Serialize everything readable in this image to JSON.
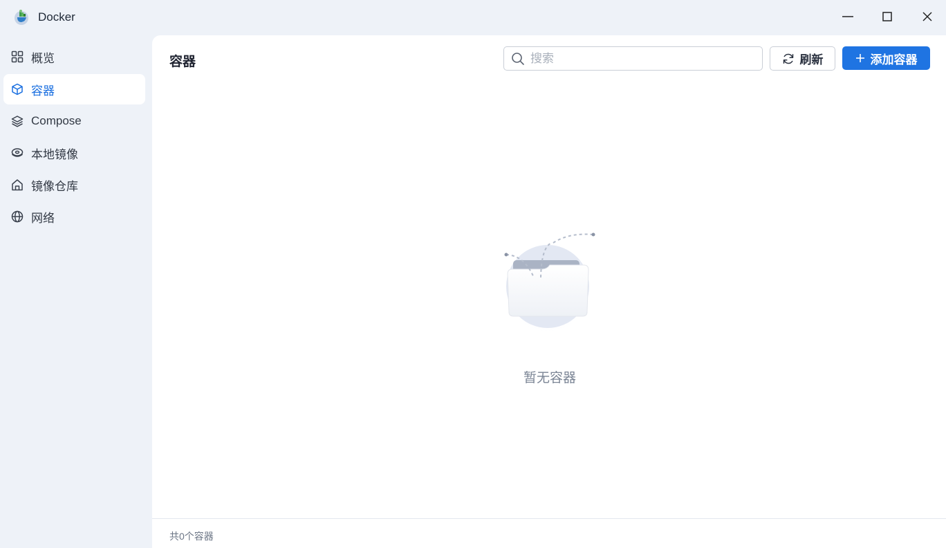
{
  "window": {
    "title": "Docker",
    "minimize_icon": "minimize-icon",
    "maximize_icon": "maximize-icon",
    "close_icon": "close-icon"
  },
  "sidebar": {
    "items": [
      {
        "label": "概览",
        "icon": "grid-icon",
        "active": false
      },
      {
        "label": "容器",
        "icon": "cube-icon",
        "active": true
      },
      {
        "label": "Compose",
        "icon": "layers-icon",
        "active": false
      },
      {
        "label": "本地镜像",
        "icon": "disk-icon",
        "active": false
      },
      {
        "label": "镜像仓库",
        "icon": "home-icon",
        "active": false
      },
      {
        "label": "网络",
        "icon": "globe-icon",
        "active": false
      }
    ]
  },
  "main": {
    "title": "容器",
    "search": {
      "placeholder": "搜索",
      "value": ""
    },
    "refresh_label": "刷新",
    "add_label": "添加容器",
    "empty_text": "暂无容器",
    "footer_text": "共0个容器"
  },
  "colors": {
    "accent": "#1f74e2",
    "sidebar_bg": "#eef2f8",
    "active_text": "#1a6fe0"
  }
}
